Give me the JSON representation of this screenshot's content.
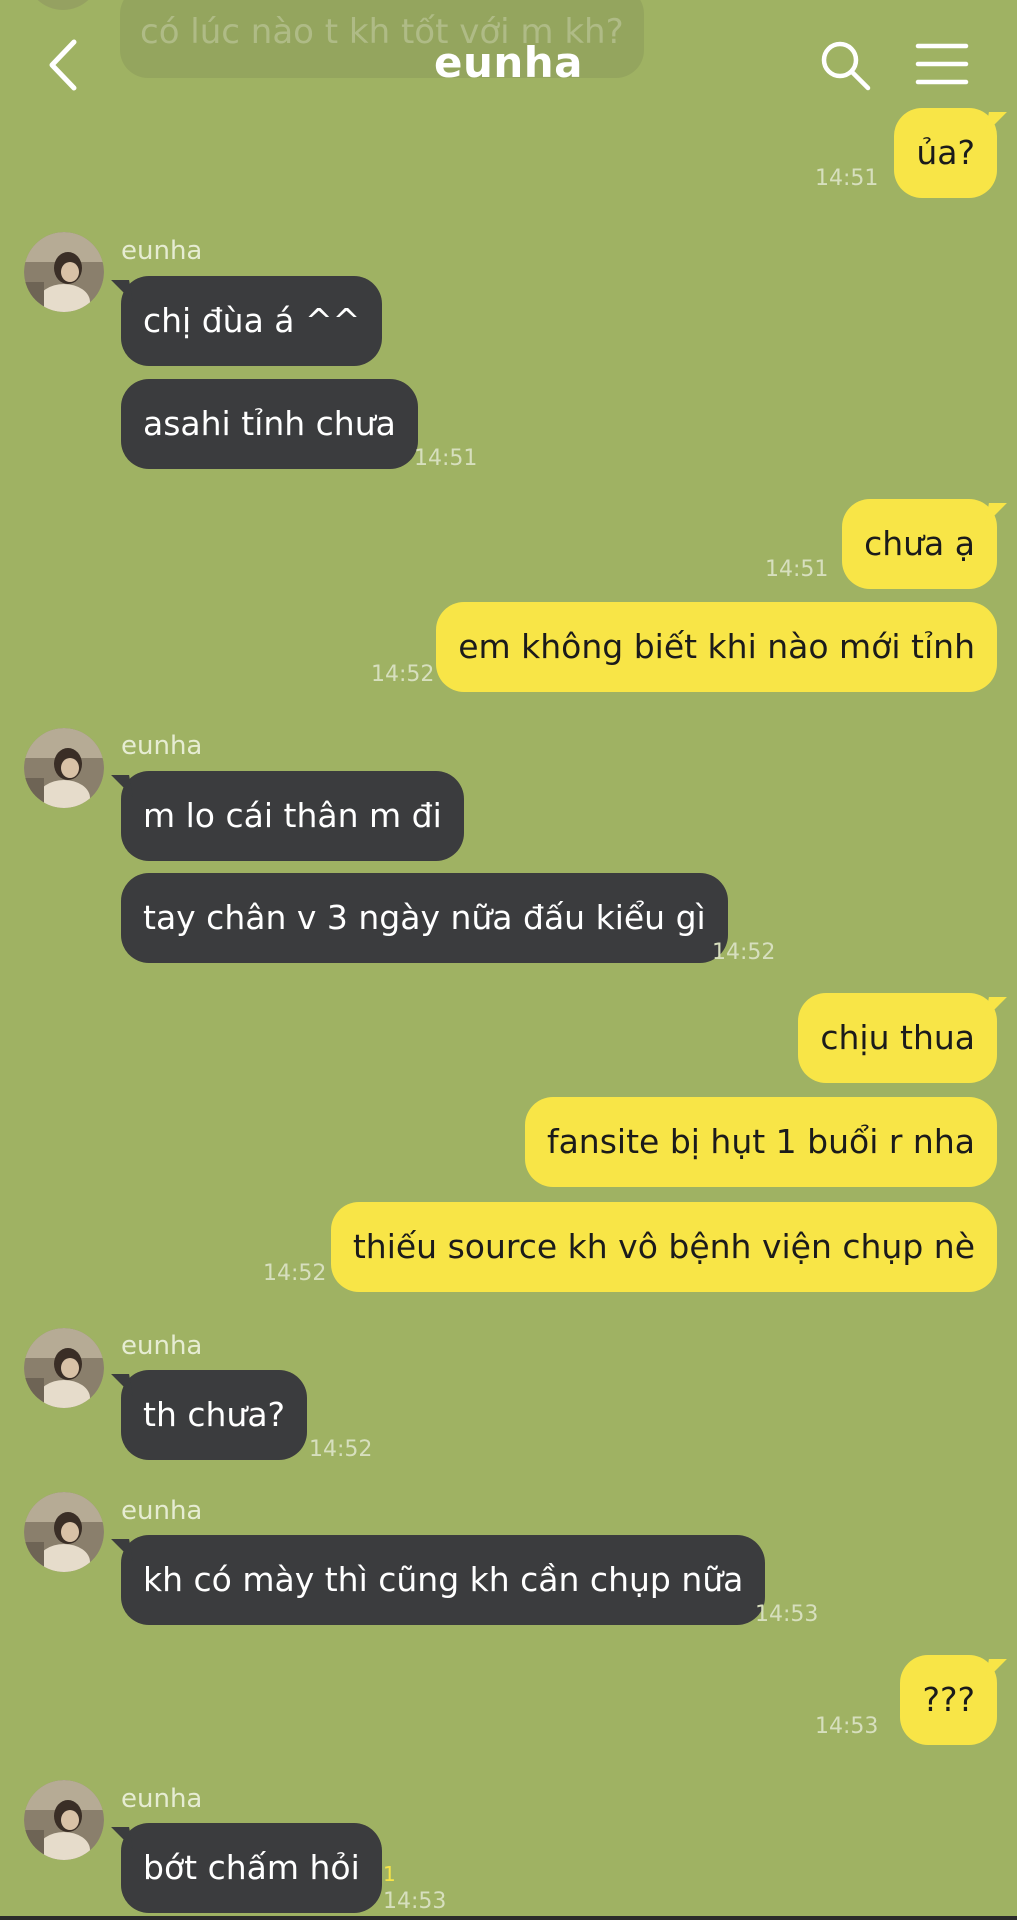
{
  "header": {
    "title": "eunha",
    "back_icon": "chevron-left-icon",
    "search_icon": "search-icon",
    "menu_icon": "hamburger-menu-icon"
  },
  "colors": {
    "background": "#9fb263",
    "incoming_bubble": "#3b3c3e",
    "outgoing_bubble": "#f8e547",
    "timestamp": "#d7dfbe",
    "unread_count": "#f8e547"
  },
  "ghost_message": {
    "text": "có lúc nào t kh tốt với m kh?"
  },
  "messages": [
    {
      "id": "m1",
      "direction": "out",
      "text": "ủa?",
      "time": "14:51"
    },
    {
      "id": "g1",
      "direction": "in",
      "sender": "eunha",
      "avatar": "avatar-photo-icon",
      "bubbles": [
        {
          "text": "chị đùa á ^^",
          "time": ""
        },
        {
          "text": "asahi tỉnh chưa",
          "time": "14:51"
        }
      ]
    },
    {
      "id": "m2",
      "direction": "out",
      "text": "chưa ạ",
      "time": "14:51"
    },
    {
      "id": "m3",
      "direction": "out",
      "text": "em không biết khi nào mới tỉnh",
      "time": "14:52"
    },
    {
      "id": "g2",
      "direction": "in",
      "sender": "eunha",
      "avatar": "avatar-photo-icon",
      "bubbles": [
        {
          "text": "m lo cái thân m đi",
          "time": ""
        },
        {
          "text": "tay chân v 3 ngày nữa đấu kiểu gì",
          "time": "14:52"
        }
      ]
    },
    {
      "id": "m4",
      "direction": "out",
      "text": "chịu thua",
      "time": ""
    },
    {
      "id": "m5",
      "direction": "out",
      "text": "fansite bị hụt 1 buổi r nha",
      "time": ""
    },
    {
      "id": "m6",
      "direction": "out",
      "text": "thiếu source kh vô bệnh viện chụp nè",
      "time": "14:52"
    },
    {
      "id": "g3",
      "direction": "in",
      "sender": "eunha",
      "avatar": "avatar-photo-icon",
      "bubbles": [
        {
          "text": "th chưa?",
          "time": "14:52"
        }
      ]
    },
    {
      "id": "g4",
      "direction": "in",
      "sender": "eunha",
      "avatar": "avatar-photo-icon",
      "bubbles": [
        {
          "text": "kh có mày thì cũng kh cần chụp nữa",
          "time": "14:53"
        }
      ]
    },
    {
      "id": "m7",
      "direction": "out",
      "text": "???",
      "time": "14:53"
    },
    {
      "id": "g5",
      "direction": "in",
      "sender": "eunha",
      "avatar": "avatar-photo-icon",
      "bubbles": [
        {
          "text": "bớt chấm hỏi",
          "time": "14:53",
          "unread": "1"
        }
      ]
    }
  ]
}
